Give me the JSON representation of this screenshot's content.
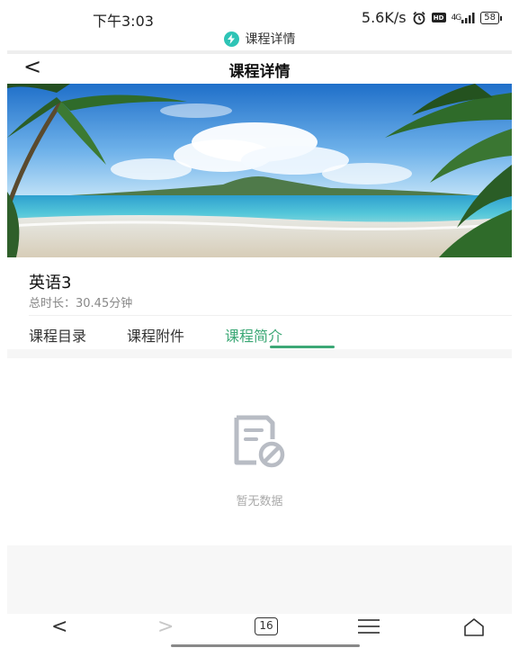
{
  "status_bar": {
    "time": "下午3:03",
    "speed": "5.6K/s",
    "hd_badge": "HD",
    "signal": "4G",
    "battery": "58"
  },
  "app_label": {
    "text": "课程详情",
    "badge_icon": "lightning-icon",
    "badge_color": "#2ec4b6"
  },
  "nav": {
    "back_icon": "back-chevron-icon",
    "back_glyph": "<",
    "title": "课程详情"
  },
  "banner": {
    "image": "tropical-beach-palms"
  },
  "course": {
    "title": "英语3",
    "duration": "总时长：30.45分钟"
  },
  "tabs": [
    {
      "label": "课程目录",
      "active": false
    },
    {
      "label": "课程附件",
      "active": false
    },
    {
      "label": "课程简介",
      "active": true
    }
  ],
  "accent_color": "#3ca876",
  "empty_state": {
    "icon": "no-data-document-icon",
    "text": "暂无数据"
  },
  "system_nav": {
    "back_glyph": "<",
    "forward_glyph": ">",
    "tab_count": "16",
    "menu_icon": "menu-icon",
    "home_icon": "home-icon"
  }
}
